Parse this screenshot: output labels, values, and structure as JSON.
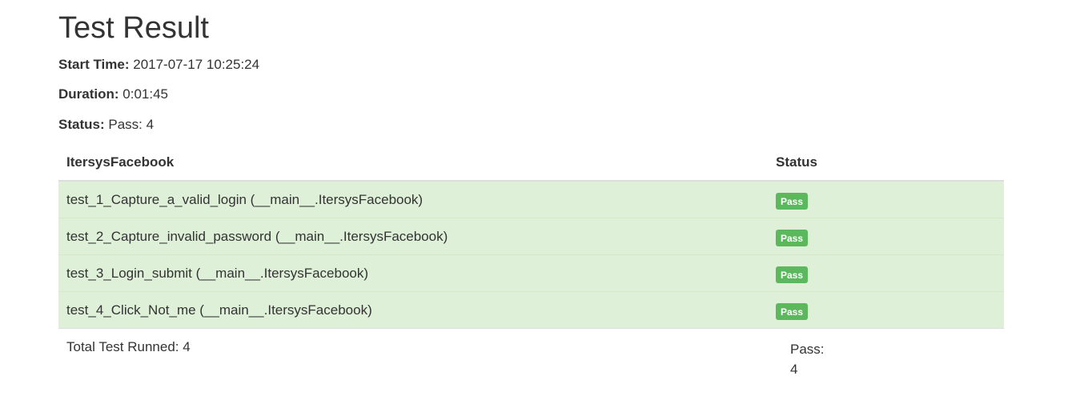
{
  "page": {
    "title": "Test Result"
  },
  "meta": {
    "start_label": "Start Time:",
    "start_value": "2017-07-17 10:25:24",
    "duration_label": "Duration:",
    "duration_value": "0:01:45",
    "status_label": "Status:",
    "status_value": "Pass: 4"
  },
  "table": {
    "headers": {
      "name": "ItersysFacebook",
      "status": "Status"
    },
    "rows": [
      {
        "name": "test_1_Capture_a_valid_login (__main__.ItersysFacebook)",
        "status": "Pass"
      },
      {
        "name": "test_2_Capture_invalid_password (__main__.ItersysFacebook)",
        "status": "Pass"
      },
      {
        "name": "test_3_Login_submit (__main__.ItersysFacebook)",
        "status": "Pass"
      },
      {
        "name": "test_4_Click_Not_me (__main__.ItersysFacebook)",
        "status": "Pass"
      }
    ]
  },
  "footer": {
    "total_label": "Total Test Runned: 4",
    "pass_label": "Pass:",
    "pass_value": "4"
  },
  "colors": {
    "row_success_bg": "#dff0d8",
    "badge_success": "#5cb85c"
  }
}
